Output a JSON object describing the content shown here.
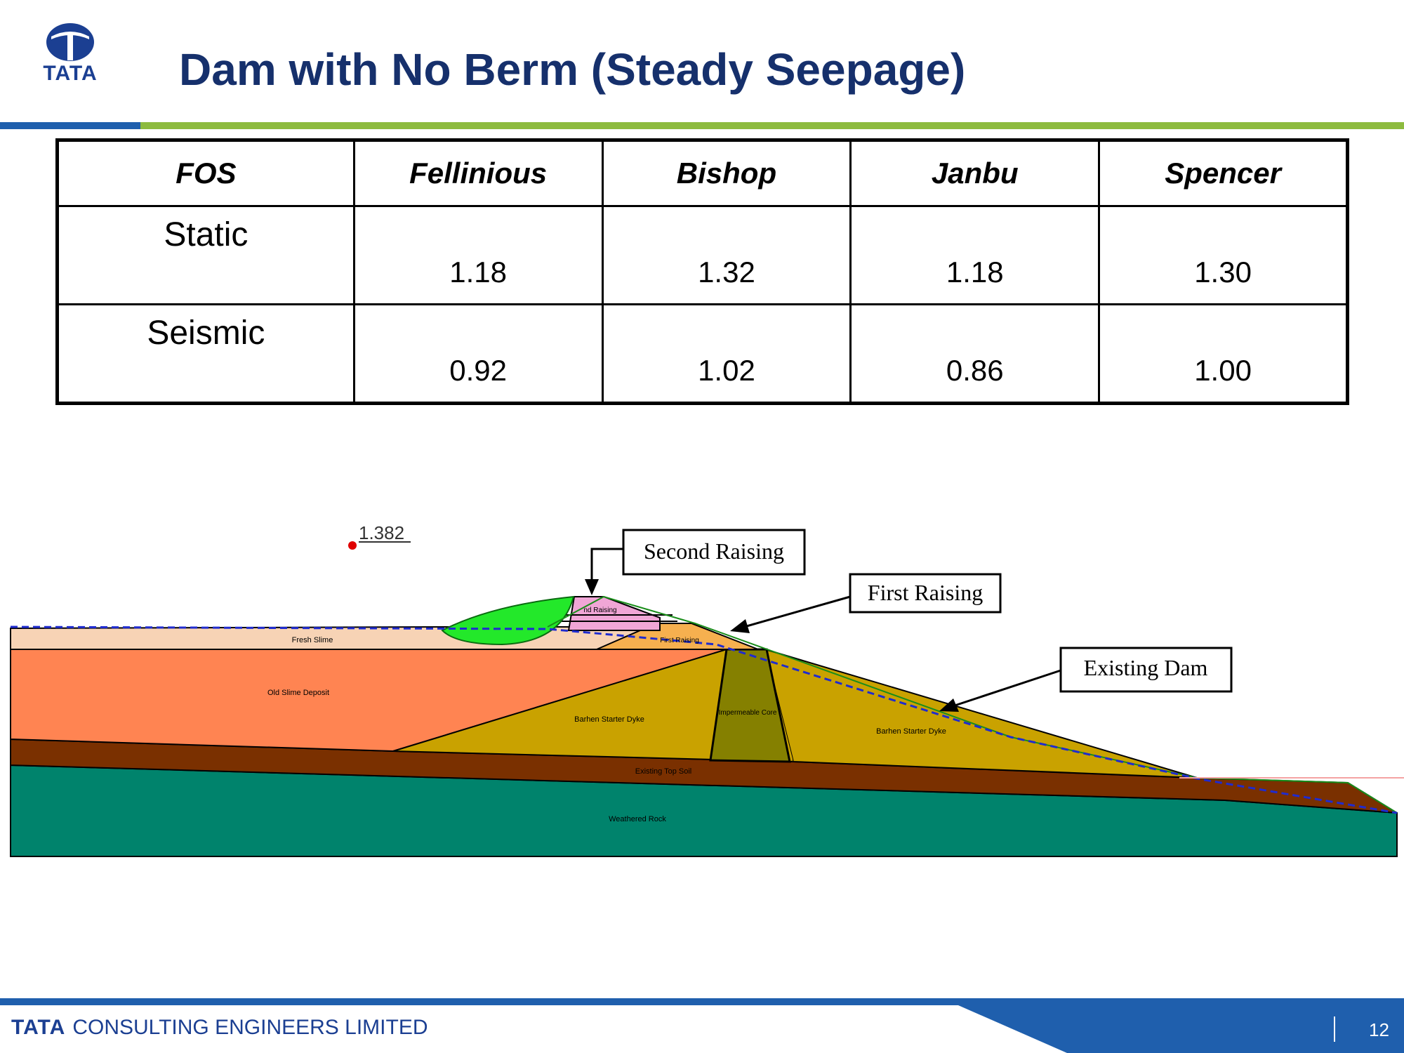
{
  "logo": {
    "icon": "tata-logo-icon",
    "word": "TATA"
  },
  "title": "Dam with No Berm (Steady Seepage)",
  "table": {
    "headers": [
      "FOS",
      "Fellinious",
      "Bishop",
      "Janbu",
      "Spencer"
    ],
    "rows": [
      {
        "label": "Static",
        "values": [
          "1.18",
          "1.32",
          "1.18",
          "1.30"
        ]
      },
      {
        "label": "Seismic",
        "values": [
          "0.92",
          "1.02",
          "0.86",
          "1.00"
        ]
      }
    ]
  },
  "diagram": {
    "fos_marker": "1.382",
    "callouts": {
      "second_raising": "Second Raising",
      "first_raising": "First Raising",
      "existing_dam": "Existing Dam"
    },
    "layers": {
      "fresh_slime": "Fresh Slime",
      "old_slime_deposit": "Old Slime Deposit",
      "second_raising": "Second Raising",
      "second_raising_partial": "nd Raising",
      "first_raising": "First Raising",
      "starter_dyke_left": "Barhen Starter Dyke",
      "impermeable_core": "Impermeable Core",
      "starter_dyke_right": "Barhen Starter Dyke",
      "existing_top_soil": "Existing Top Soil",
      "weathered_rock": "Weathered Rock"
    },
    "colors": {
      "fresh_slime": "#f7d3b5",
      "old_slime": "#ff8452",
      "dyke": "#c9a200",
      "core": "#858000",
      "top_soil": "#7a3000",
      "rock": "#00836c",
      "slip_circle": "#23e82a",
      "second_raising": "#f0a6d6",
      "first_raising": "#f6b04f",
      "phreatic_line": "#1f2bcf"
    }
  },
  "footer": {
    "brand": "TATA",
    "company": "CONSULTING ENGINEERS LIMITED",
    "page": "12"
  }
}
